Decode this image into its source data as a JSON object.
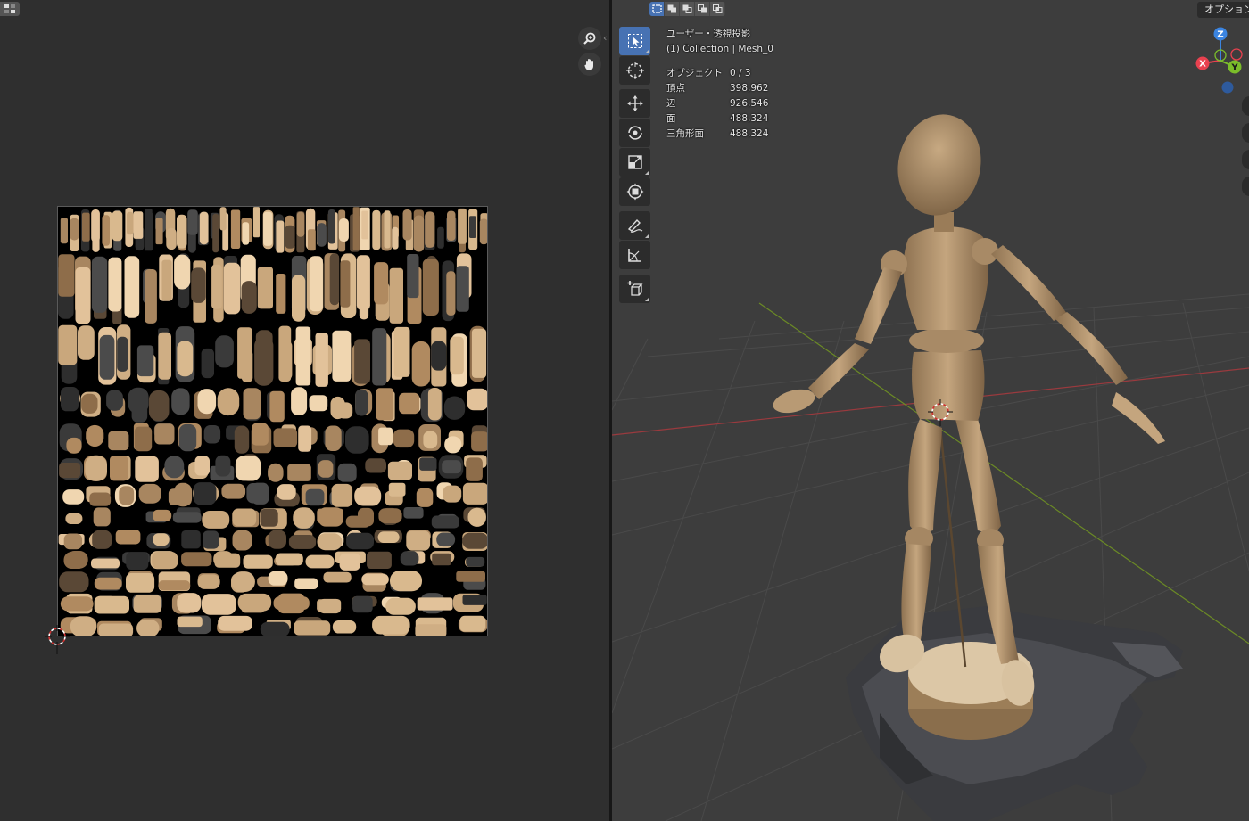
{
  "uv_editor": {
    "header_icon": "image-editor-icon",
    "nav": {
      "zoom_icon": "zoom-icon",
      "pan_icon": "hand-pan-icon"
    },
    "collapse_icon": "chevron-left-icon",
    "collapse_glyph": "‹",
    "texture": "texture-atlas-image",
    "cursor": "2d-cursor-icon"
  },
  "viewport": {
    "select_modes": [
      "select-new-icon",
      "select-extend-icon",
      "select-subtract-icon",
      "select-invert-icon",
      "select-intersect-icon"
    ],
    "options_label": "オプション",
    "toolbar": [
      "select-box-icon",
      "cursor-icon",
      "move-icon",
      "rotate-icon",
      "scale-icon",
      "transform-icon",
      "annotate-icon",
      "measure-icon",
      "add-cube-icon"
    ],
    "view_info": {
      "view_name": "ユーザー・透視投影",
      "collection": "(1) Collection | Mesh_0"
    },
    "stats": [
      {
        "label": "オブジェクト",
        "value": "0 / 3"
      },
      {
        "label": "頂点",
        "value": "398,962"
      },
      {
        "label": "辺",
        "value": "926,546"
      },
      {
        "label": "面",
        "value": "488,324"
      },
      {
        "label": "三角形面",
        "value": "488,324"
      }
    ],
    "gizmo": {
      "x": "X",
      "y": "Y",
      "z": "Z"
    },
    "colors": {
      "x_axis": "#e8414f",
      "y_axis": "#7bbd2a",
      "z_axis": "#3b84e0",
      "active_tool": "#4772b3"
    }
  }
}
